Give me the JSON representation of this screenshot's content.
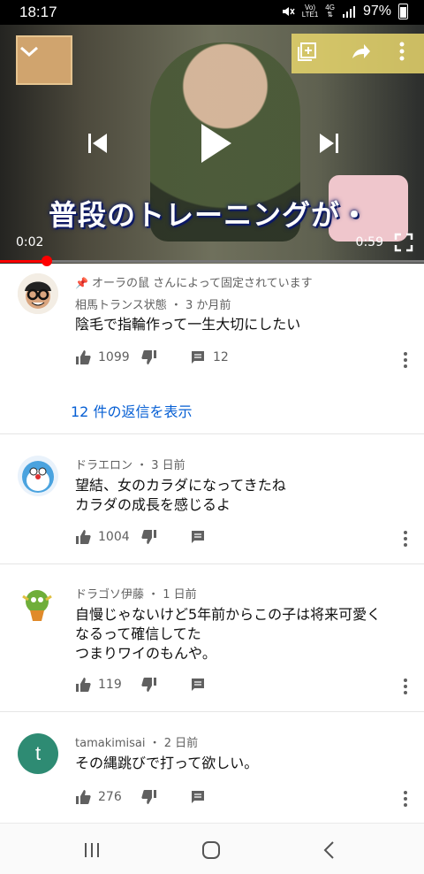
{
  "status": {
    "time": "18:17",
    "network_top": "Vo)",
    "network_bottom": "LTE1",
    "network_type": "4G",
    "battery": "97%"
  },
  "video": {
    "caption": "普段のトレーニングが・",
    "elapsed": "0:02",
    "duration": "0:59",
    "progress": 0.11
  },
  "comments": [
    {
      "pinned_text": "オーラの鼠 さんによって固定されています",
      "author": "相馬トランス状態",
      "time": "3 か月前",
      "text": [
        "陰毛で指輪作って一生大切にしたい"
      ],
      "likes": "1099",
      "reply_count": "12",
      "replies_link": "12 件の返信を表示"
    },
    {
      "author": "ドラエロン",
      "time": "3 日前",
      "text": [
        "望結、女のカラダになってきたね",
        "カラダの成長を感じるよ"
      ],
      "likes": "1004"
    },
    {
      "author": "ドラゴソ伊藤",
      "time": "1 日前",
      "text": [
        "自慢じゃないけど5年前からこの子は将来可愛く",
        "なるって確信してた",
        "つまりワイのもんや。"
      ],
      "likes": "119"
    },
    {
      "author": "tamakimisai",
      "time": "2 日前",
      "avatar_letter": "t",
      "text": [
        "その縄跳びで打って欲しい。"
      ],
      "likes": "276"
    }
  ],
  "colors": {
    "accent_red": "#ff0000",
    "link_blue": "#065fd4",
    "avatar_teal": "#2e8b73"
  }
}
